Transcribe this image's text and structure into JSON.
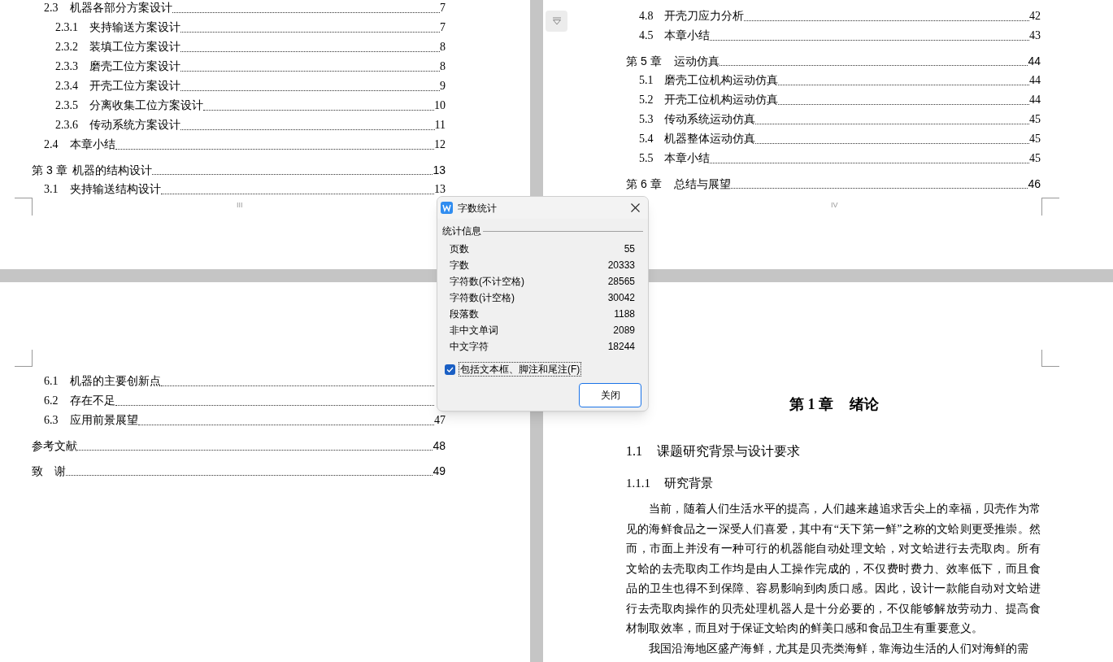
{
  "toc_pages": [
    {
      "footer": "III",
      "entries": [
        {
          "kind": "section",
          "number": "2.3",
          "title": "机器各部分方案设计",
          "page": "7",
          "children": [
            {
              "kind": "subsection",
              "number": "2.3.1",
              "title": "夹持输送方案设计",
              "page": "7"
            },
            {
              "kind": "subsection",
              "number": "2.3.2",
              "title": "装填工位方案设计",
              "page": "8"
            },
            {
              "kind": "subsection",
              "number": "2.3.3",
              "title": "磨壳工位方案设计",
              "page": "8"
            },
            {
              "kind": "subsection",
              "number": "2.3.4",
              "title": "开壳工位方案设计",
              "page": "9"
            },
            {
              "kind": "subsection",
              "number": "2.3.5",
              "title": "分离收集工位方案设计",
              "page": "10"
            },
            {
              "kind": "subsection",
              "number": "2.3.6",
              "title": "传动系统方案设计",
              "page": "11"
            }
          ]
        },
        {
          "kind": "section",
          "number": "2.4",
          "title": "本章小结",
          "page": "12"
        },
        {
          "kind": "chapter",
          "number": "第 3 章",
          "title": "机器的结构设计",
          "page": "13",
          "children": [
            {
              "kind": "section",
              "number": "3.1",
              "title": "夹持输送结构设计",
              "page": "13"
            }
          ]
        }
      ]
    },
    {
      "footer": "IV",
      "entries": [
        {
          "kind": "section",
          "number": "4.8",
          "title": "开壳刀应力分析",
          "page": "42"
        },
        {
          "kind": "section",
          "number": "4.5",
          "title": "本章小结",
          "page": "43"
        },
        {
          "kind": "chapter",
          "number": "第 5 章",
          "title": "运动仿真",
          "page": "44",
          "children": [
            {
              "kind": "section",
              "number": "5.1",
              "title": "磨壳工位机构运动仿真",
              "page": "44"
            },
            {
              "kind": "section",
              "number": "5.2",
              "title": "开壳工位机构运动仿真",
              "page": "44"
            },
            {
              "kind": "section",
              "number": "5.3",
              "title": "传动系统运动仿真",
              "page": "45"
            },
            {
              "kind": "section",
              "number": "5.4",
              "title": "机器整体运动仿真",
              "page": "45"
            },
            {
              "kind": "section",
              "number": "5.5",
              "title": "本章小结",
              "page": "45"
            }
          ]
        },
        {
          "kind": "chapter",
          "number": "第 6 章",
          "title": "总结与展望",
          "page": "46"
        }
      ]
    },
    {
      "entries": [
        {
          "kind": "section",
          "number": "6.1",
          "title": "机器的主要创新点"
        },
        {
          "kind": "section",
          "number": "6.2",
          "title": "存在不足"
        },
        {
          "kind": "section",
          "number": "6.3",
          "title": "应用前景展望",
          "page": "47"
        },
        {
          "kind": "chapter",
          "title": "参考文献",
          "page": "48"
        },
        {
          "kind": "chapter",
          "title": "致　谢",
          "page": "49"
        }
      ]
    }
  ],
  "body_page": {
    "chapter_heading": {
      "number": "第 1 章",
      "title": "绪论"
    },
    "section_heading": {
      "number": "1.1",
      "title": "课题研究背景与设计要求"
    },
    "subsection_heading": {
      "number": "1.1.1",
      "title": "研究背景"
    },
    "paragraphs": [
      "当前，随着人们生活水平的提高，人们越来越追求舌尖上的幸福，贝壳作为常见的海鲜食品之一深受人们喜爱，其中有“天下第一鲜”之称的文蛤则更受推崇。然而，市面上并没有一种可行的机器能自动处理文蛤，对文蛤进行去壳取肉。所有文蛤的去壳取肉工作均是由人工操作完成的，不仅费时费力、效率低下，而且食品的卫生也得不到保障、容易影响到肉质口感。因此，设计一款能自动对文蛤进行去壳取肉操作的贝壳处理机器人是十分必要的，不仅能够解放劳动力、提高食材制取效率，而且对于保证文蛤肉的鲜美口感和食品卫生有重要意义。",
      "我国沿海地区盛产海鲜，尤其是贝壳类海鲜，靠海边生活的人们对海鲜的需"
    ]
  },
  "word_count_dialog": {
    "title": "字数统计",
    "group_label": "统计信息",
    "stats": [
      {
        "label": "页数",
        "value": "55"
      },
      {
        "label": "字数",
        "value": "20333"
      },
      {
        "label": "字符数(不计空格)",
        "value": "28565"
      },
      {
        "label": "字符数(计空格)",
        "value": "30042"
      },
      {
        "label": "段落数",
        "value": "1188"
      },
      {
        "label": "非中文单词",
        "value": "2089"
      },
      {
        "label": "中文字符",
        "value": "18244"
      }
    ],
    "checkbox": {
      "label": "包括文本框、脚注和尾注(F)",
      "checked": true
    },
    "button": "关闭"
  }
}
